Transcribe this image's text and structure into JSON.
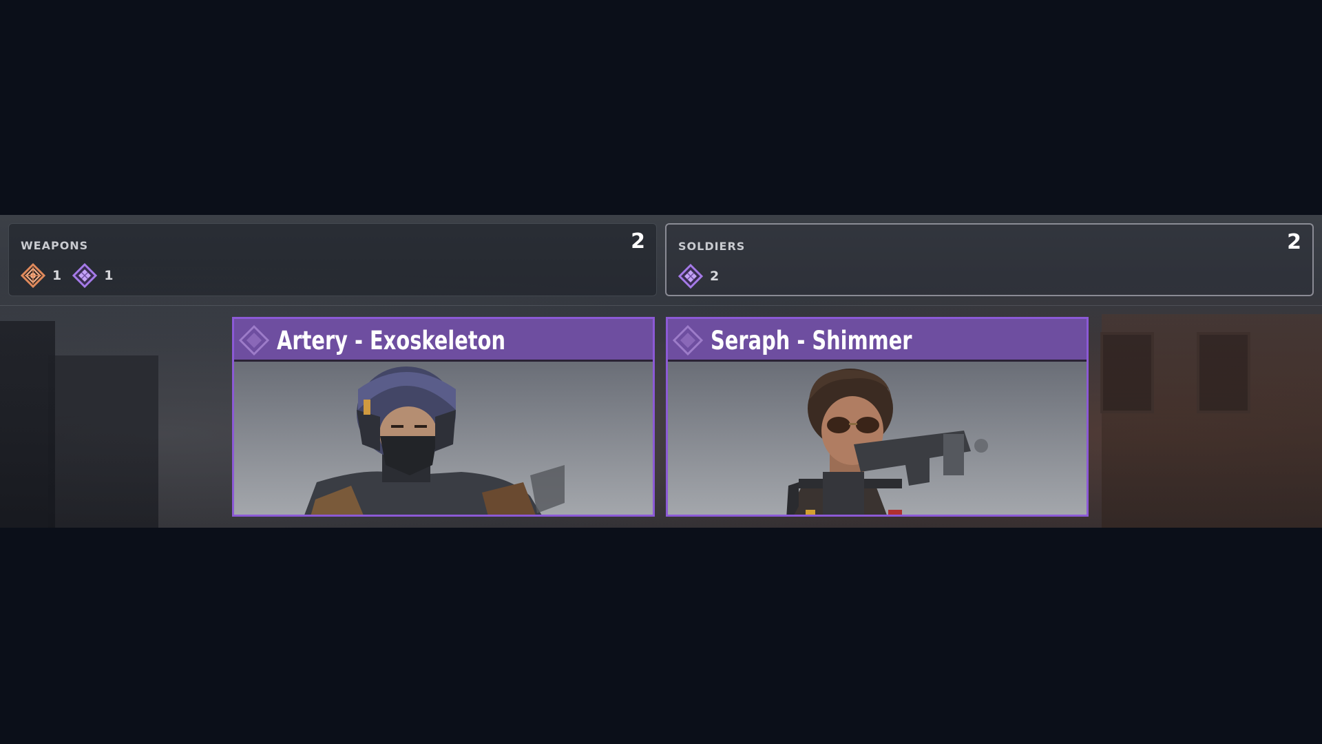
{
  "summaries": [
    {
      "title": "WEAPONS",
      "total": "2",
      "rarities": [
        {
          "icon": "legendary-rarity-icon",
          "count": "1"
        },
        {
          "icon": "epic-rarity-icon",
          "count": "1"
        }
      ]
    },
    {
      "title": "SOLDIERS",
      "total": "2",
      "rarities": [
        {
          "icon": "epic-rarity-icon",
          "count": "2"
        }
      ]
    }
  ],
  "cards": [
    {
      "title": "Artery - Exoskeleton",
      "rarity": "epic"
    },
    {
      "title": "Seraph - Shimmer",
      "rarity": "epic"
    }
  ],
  "colors": {
    "epic": "#8c5ad6",
    "epic_header": "#6e4ea0",
    "legendary": "#e08a5c",
    "background": "#0b0f19"
  }
}
